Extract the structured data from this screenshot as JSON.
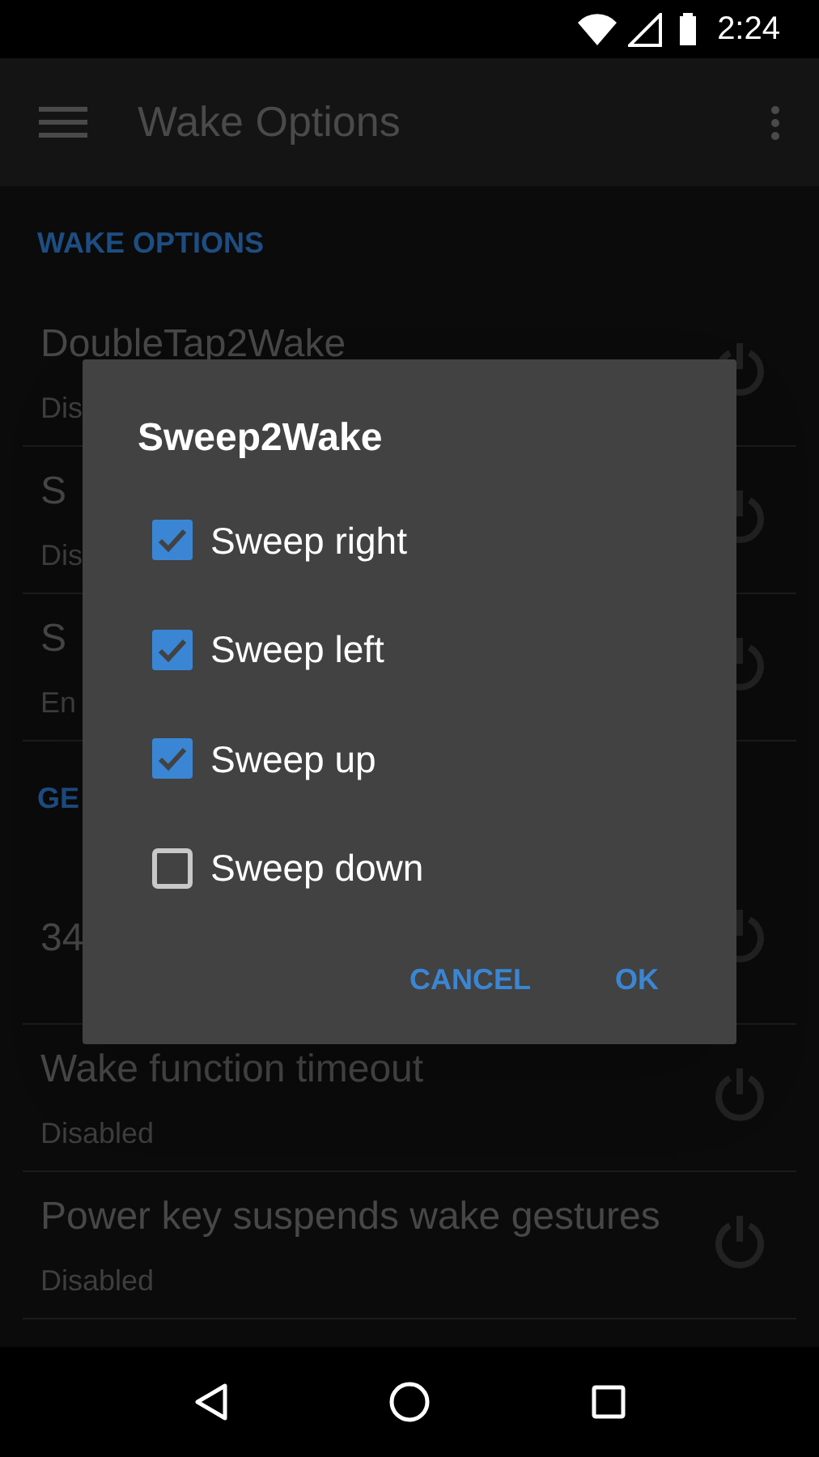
{
  "status_bar": {
    "time": "2:24"
  },
  "toolbar": {
    "title": "Wake Options"
  },
  "sections": [
    {
      "header": "WAKE OPTIONS",
      "items": [
        {
          "title": "DoubleTap2Wake",
          "subtitle": "Dis"
        },
        {
          "title": "S",
          "subtitle": "Dis"
        },
        {
          "title": "S",
          "subtitle": "En"
        }
      ]
    },
    {
      "header": "GE",
      "items": [
        {
          "title": "34"
        },
        {
          "title": "Wake function timeout",
          "subtitle": "Disabled"
        },
        {
          "title": "Power key suspends wake gestures",
          "subtitle": "Disabled"
        }
      ]
    }
  ],
  "dialog": {
    "title": "Sweep2Wake",
    "options": [
      {
        "label": "Sweep right",
        "checked": true
      },
      {
        "label": "Sweep left",
        "checked": true
      },
      {
        "label": "Sweep up",
        "checked": true
      },
      {
        "label": "Sweep down",
        "checked": false
      }
    ],
    "buttons": [
      "CANCEL",
      "OK"
    ]
  }
}
